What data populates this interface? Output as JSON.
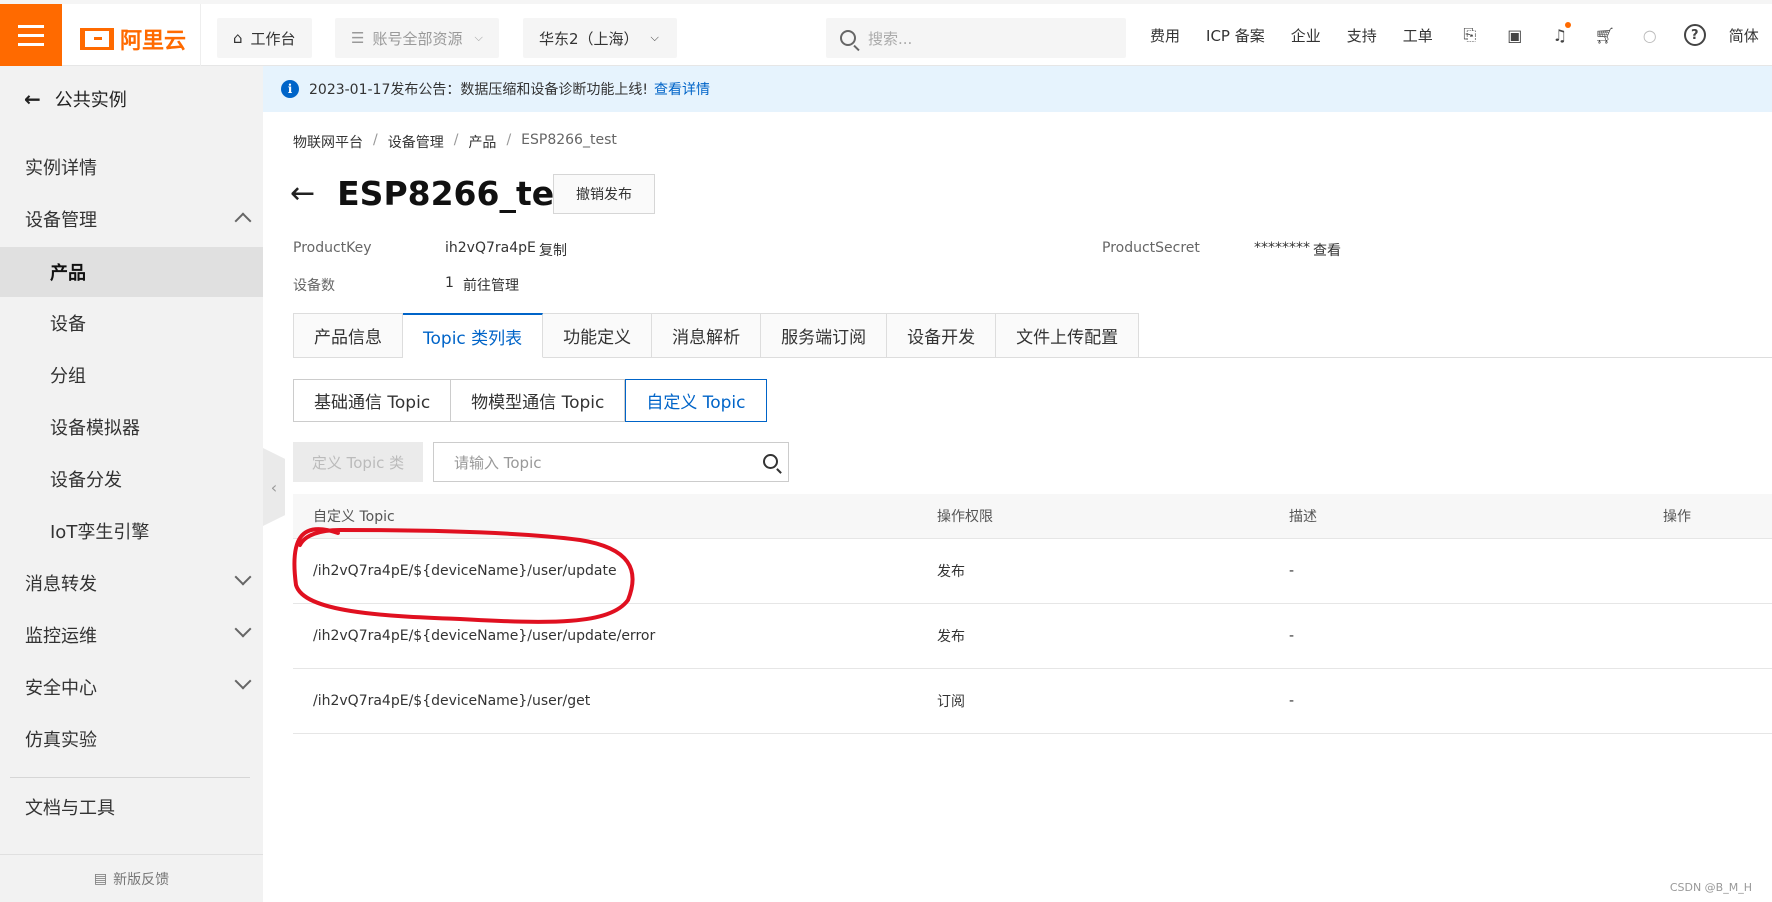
{
  "brand": {
    "name": "阿里云",
    "color": "#ff6a00"
  },
  "topbar": {
    "workbench": "工作台",
    "resources": "账号全部资源",
    "region": "华东2（上海）",
    "search_placeholder": "搜索...",
    "links": [
      "费用",
      "ICP 备案",
      "企业",
      "支持",
      "工单"
    ],
    "lang": "简体"
  },
  "sidebar": {
    "back_label": "公共实例",
    "items": [
      {
        "label": "实例详情"
      },
      {
        "label": "设备管理"
      },
      {
        "label": "产品"
      },
      {
        "label": "设备"
      },
      {
        "label": "分组"
      },
      {
        "label": "设备模拟器"
      },
      {
        "label": "设备分发"
      },
      {
        "label": "IoT孪生引擎"
      },
      {
        "label": "消息转发"
      },
      {
        "label": "监控运维"
      },
      {
        "label": "安全中心"
      },
      {
        "label": "仿真实验"
      },
      {
        "label": "文档与工具"
      }
    ],
    "feedback": "新版反馈"
  },
  "notice": {
    "text": "2023-01-17发布公告：数据压缩和设备诊断功能上线!",
    "link": "查看详情"
  },
  "breadcrumb": [
    "物联网平台",
    "设备管理",
    "产品",
    "ESP8266_test"
  ],
  "product": {
    "title": "ESP8266_test",
    "revoke_label": "撤销发布",
    "key_label": "ProductKey",
    "key_value": "ih2vQ7ra4pE",
    "copy_label": "复制",
    "secret_label": "ProductSecret",
    "secret_value": "********",
    "view_label": "查看",
    "count_label": "设备数",
    "count_value": "1",
    "manage_label": "前往管理"
  },
  "tabs": [
    "产品信息",
    "Topic 类列表",
    "功能定义",
    "消息解析",
    "服务端订阅",
    "设备开发",
    "文件上传配置"
  ],
  "subtabs": [
    "基础通信 Topic",
    "物模型通信 Topic",
    "自定义 Topic"
  ],
  "toolbar": {
    "define_label": "定义 Topic 类",
    "search_placeholder": "请输入 Topic"
  },
  "table": {
    "headers": [
      "自定义 Topic",
      "操作权限",
      "描述",
      "操作"
    ],
    "rows": [
      {
        "topic": "/ih2vQ7ra4pE/${deviceName}/user/update",
        "permission": "发布",
        "desc": "-"
      },
      {
        "topic": "/ih2vQ7ra4pE/${deviceName}/user/update/error",
        "permission": "发布",
        "desc": "-"
      },
      {
        "topic": "/ih2vQ7ra4pE/${deviceName}/user/get",
        "permission": "订阅",
        "desc": "-"
      }
    ]
  },
  "watermark": "CSDN @B_M_H",
  "accent_color": "#0064c8"
}
